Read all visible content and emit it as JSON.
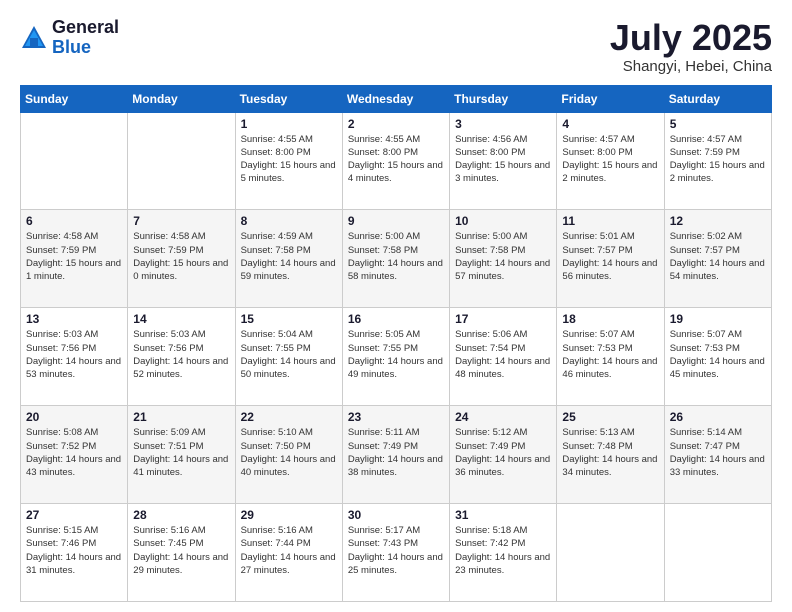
{
  "header": {
    "logo_general": "General",
    "logo_blue": "Blue",
    "month_title": "July 2025",
    "location": "Shangyi, Hebei, China"
  },
  "calendar": {
    "days_of_week": [
      "Sunday",
      "Monday",
      "Tuesday",
      "Wednesday",
      "Thursday",
      "Friday",
      "Saturday"
    ],
    "weeks": [
      [
        {
          "day": "",
          "info": ""
        },
        {
          "day": "",
          "info": ""
        },
        {
          "day": "1",
          "info": "Sunrise: 4:55 AM\nSunset: 8:00 PM\nDaylight: 15 hours\nand 5 minutes."
        },
        {
          "day": "2",
          "info": "Sunrise: 4:55 AM\nSunset: 8:00 PM\nDaylight: 15 hours\nand 4 minutes."
        },
        {
          "day": "3",
          "info": "Sunrise: 4:56 AM\nSunset: 8:00 PM\nDaylight: 15 hours\nand 3 minutes."
        },
        {
          "day": "4",
          "info": "Sunrise: 4:57 AM\nSunset: 8:00 PM\nDaylight: 15 hours\nand 2 minutes."
        },
        {
          "day": "5",
          "info": "Sunrise: 4:57 AM\nSunset: 7:59 PM\nDaylight: 15 hours\nand 2 minutes."
        }
      ],
      [
        {
          "day": "6",
          "info": "Sunrise: 4:58 AM\nSunset: 7:59 PM\nDaylight: 15 hours\nand 1 minute."
        },
        {
          "day": "7",
          "info": "Sunrise: 4:58 AM\nSunset: 7:59 PM\nDaylight: 15 hours\nand 0 minutes."
        },
        {
          "day": "8",
          "info": "Sunrise: 4:59 AM\nSunset: 7:58 PM\nDaylight: 14 hours\nand 59 minutes."
        },
        {
          "day": "9",
          "info": "Sunrise: 5:00 AM\nSunset: 7:58 PM\nDaylight: 14 hours\nand 58 minutes."
        },
        {
          "day": "10",
          "info": "Sunrise: 5:00 AM\nSunset: 7:58 PM\nDaylight: 14 hours\nand 57 minutes."
        },
        {
          "day": "11",
          "info": "Sunrise: 5:01 AM\nSunset: 7:57 PM\nDaylight: 14 hours\nand 56 minutes."
        },
        {
          "day": "12",
          "info": "Sunrise: 5:02 AM\nSunset: 7:57 PM\nDaylight: 14 hours\nand 54 minutes."
        }
      ],
      [
        {
          "day": "13",
          "info": "Sunrise: 5:03 AM\nSunset: 7:56 PM\nDaylight: 14 hours\nand 53 minutes."
        },
        {
          "day": "14",
          "info": "Sunrise: 5:03 AM\nSunset: 7:56 PM\nDaylight: 14 hours\nand 52 minutes."
        },
        {
          "day": "15",
          "info": "Sunrise: 5:04 AM\nSunset: 7:55 PM\nDaylight: 14 hours\nand 50 minutes."
        },
        {
          "day": "16",
          "info": "Sunrise: 5:05 AM\nSunset: 7:55 PM\nDaylight: 14 hours\nand 49 minutes."
        },
        {
          "day": "17",
          "info": "Sunrise: 5:06 AM\nSunset: 7:54 PM\nDaylight: 14 hours\nand 48 minutes."
        },
        {
          "day": "18",
          "info": "Sunrise: 5:07 AM\nSunset: 7:53 PM\nDaylight: 14 hours\nand 46 minutes."
        },
        {
          "day": "19",
          "info": "Sunrise: 5:07 AM\nSunset: 7:53 PM\nDaylight: 14 hours\nand 45 minutes."
        }
      ],
      [
        {
          "day": "20",
          "info": "Sunrise: 5:08 AM\nSunset: 7:52 PM\nDaylight: 14 hours\nand 43 minutes."
        },
        {
          "day": "21",
          "info": "Sunrise: 5:09 AM\nSunset: 7:51 PM\nDaylight: 14 hours\nand 41 minutes."
        },
        {
          "day": "22",
          "info": "Sunrise: 5:10 AM\nSunset: 7:50 PM\nDaylight: 14 hours\nand 40 minutes."
        },
        {
          "day": "23",
          "info": "Sunrise: 5:11 AM\nSunset: 7:49 PM\nDaylight: 14 hours\nand 38 minutes."
        },
        {
          "day": "24",
          "info": "Sunrise: 5:12 AM\nSunset: 7:49 PM\nDaylight: 14 hours\nand 36 minutes."
        },
        {
          "day": "25",
          "info": "Sunrise: 5:13 AM\nSunset: 7:48 PM\nDaylight: 14 hours\nand 34 minutes."
        },
        {
          "day": "26",
          "info": "Sunrise: 5:14 AM\nSunset: 7:47 PM\nDaylight: 14 hours\nand 33 minutes."
        }
      ],
      [
        {
          "day": "27",
          "info": "Sunrise: 5:15 AM\nSunset: 7:46 PM\nDaylight: 14 hours\nand 31 minutes."
        },
        {
          "day": "28",
          "info": "Sunrise: 5:16 AM\nSunset: 7:45 PM\nDaylight: 14 hours\nand 29 minutes."
        },
        {
          "day": "29",
          "info": "Sunrise: 5:16 AM\nSunset: 7:44 PM\nDaylight: 14 hours\nand 27 minutes."
        },
        {
          "day": "30",
          "info": "Sunrise: 5:17 AM\nSunset: 7:43 PM\nDaylight: 14 hours\nand 25 minutes."
        },
        {
          "day": "31",
          "info": "Sunrise: 5:18 AM\nSunset: 7:42 PM\nDaylight: 14 hours\nand 23 minutes."
        },
        {
          "day": "",
          "info": ""
        },
        {
          "day": "",
          "info": ""
        }
      ]
    ]
  }
}
